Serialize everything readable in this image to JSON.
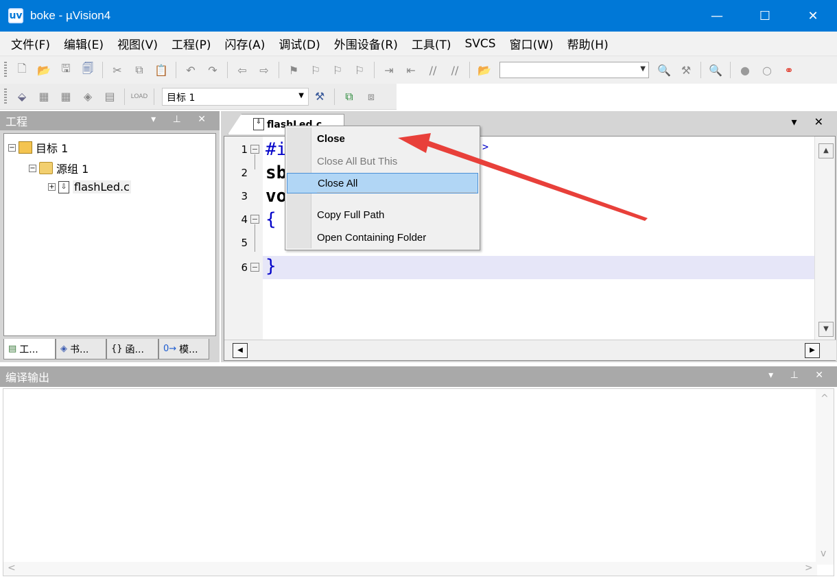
{
  "window": {
    "title": "boke  - µVision4",
    "app_icon": "uv",
    "minimize": "—",
    "maximize": "☐",
    "close": "✕"
  },
  "menu": [
    "文件(F)",
    "编辑(E)",
    "视图(V)",
    "工程(P)",
    "闪存(A)",
    "调试(D)",
    "外围设备(R)",
    "工具(T)",
    "SVCS",
    "窗口(W)",
    "帮助(H)"
  ],
  "toolbar2": {
    "target": "目标 1"
  },
  "project_panel": {
    "title": "工程",
    "controls": "▾ ⊥ ✕",
    "tree": {
      "target": "目标 1",
      "group": "源组 1",
      "file": "flashLed.c"
    },
    "tabs": [
      "工...",
      "书...",
      "函...",
      "模..."
    ]
  },
  "editor": {
    "tab_label": "flashLed.c",
    "controls": "▾ ✕",
    "line_numbers": [
      "1",
      "2",
      "3",
      "4",
      "5",
      "6"
    ],
    "code_lines": [
      "#i",
      "sb",
      "vo",
      "{",
      "",
      "}"
    ],
    "visible_fragment": ">"
  },
  "context_menu": {
    "items": [
      "Close",
      "Close All But This",
      "Close All",
      "Copy Full Path",
      "Open Containing Folder"
    ],
    "selected": "Close All"
  },
  "annotation": {
    "arrow_color": "#e8403a"
  },
  "output_panel": {
    "title": "编译输出",
    "controls": "▾ ⊥ ✕"
  },
  "colors": {
    "titlebar": "#0078d7",
    "selection": "#b1d6f5",
    "line_highlight": "#e6e6f8"
  }
}
